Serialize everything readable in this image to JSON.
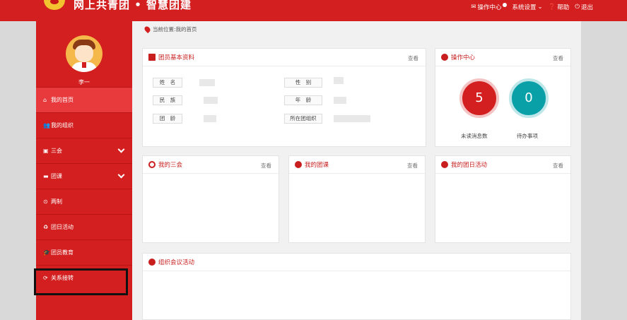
{
  "header": {
    "title": "网上共青团 • 智慧团建",
    "links": [
      "操作中心",
      "系统设置",
      "帮助",
      "退出"
    ]
  },
  "sidebar": {
    "user_name": "李一",
    "items": [
      {
        "label": "我的首页",
        "icon": "home-icon"
      },
      {
        "label": "我的组织",
        "icon": "users-icon"
      },
      {
        "label": "三会",
        "icon": "calendar-icon"
      },
      {
        "label": "团课",
        "icon": "folder-icon"
      },
      {
        "label": "两制",
        "icon": "circle-icon"
      },
      {
        "label": "团日活动",
        "icon": "recycle-icon"
      },
      {
        "label": "团员教育",
        "icon": "graduation-icon"
      },
      {
        "label": "关系接转",
        "icon": "refresh-icon"
      }
    ]
  },
  "breadcrumb": "当前位置:我的首页",
  "profile": {
    "title": "团员基本资料",
    "view": "查看",
    "labels": {
      "name": "姓　名",
      "gender": "性　别",
      "ethnicity": "民　族",
      "age": "年　龄",
      "league_age": "团　龄",
      "org": "所在团组织"
    }
  },
  "ops": {
    "title": "操作中心",
    "view": "查看",
    "unread_count": "5",
    "unread_label": "未读消息数",
    "todo_count": "0",
    "todo_label": "待办事项"
  },
  "panels": {
    "sanhui": {
      "title": "我的三会",
      "view": "查看"
    },
    "tuanke": {
      "title": "我的团课",
      "view": "查看"
    },
    "tuanri": {
      "title": "我的团日活动",
      "view": "查看"
    },
    "meeting": {
      "title": "组织会议活动"
    }
  },
  "colors": {
    "brand_red": "#d31f1f",
    "teal": "#0aa0a8"
  }
}
